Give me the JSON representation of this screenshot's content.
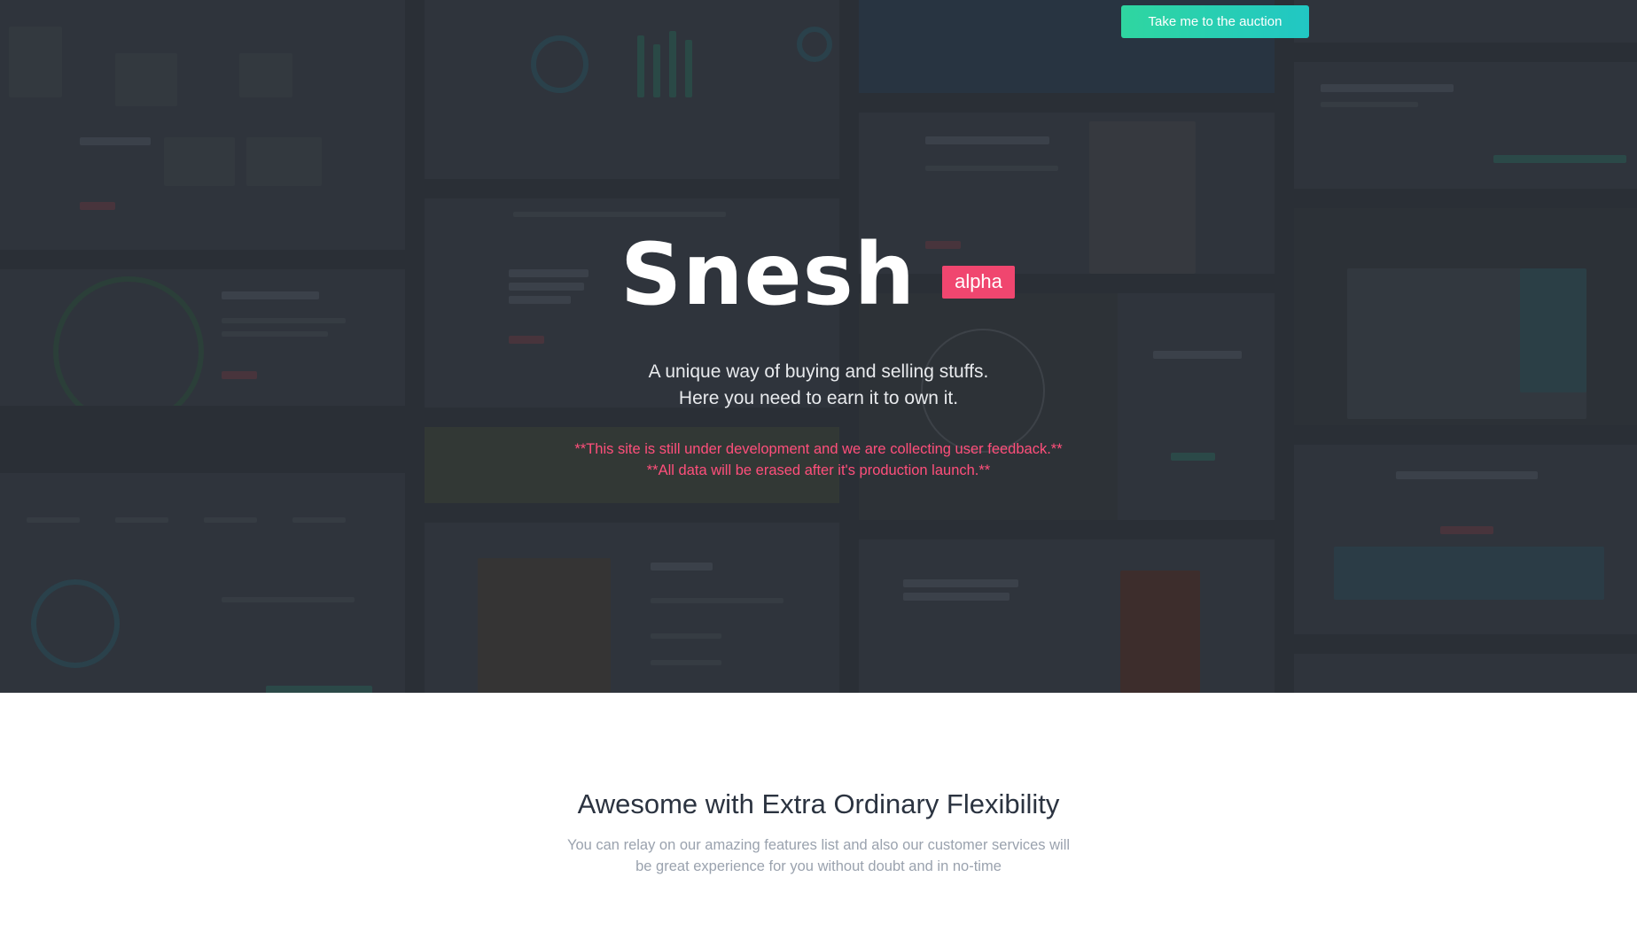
{
  "hero": {
    "cta_label": "Take me to the auction",
    "brand_name": "Snesh",
    "badge": "alpha",
    "tagline_line1": "A unique way of buying and selling stuffs.",
    "tagline_line2": "Here you need to earn it to own it.",
    "notice_line1": "**This site is still under development and we are collecting user feedback.**",
    "notice_line2": "**All data will be erased after it's production launch.**"
  },
  "features": {
    "title": "Awesome with Extra Ordinary Flexibility",
    "subtitle_line1": "You can relay on our amazing features list and also our customer services will",
    "subtitle_line2": "be great experience for you without doubt and in no-time"
  },
  "colors": {
    "hero_bg": "#2d3239",
    "cta_gradient_start": "#2fd6a0",
    "cta_gradient_end": "#21c7c4",
    "badge_bg": "#f0466f",
    "notice_text": "#ff4f7b",
    "title_text": "#2b3340",
    "subtitle_text": "#9aa2ae"
  }
}
